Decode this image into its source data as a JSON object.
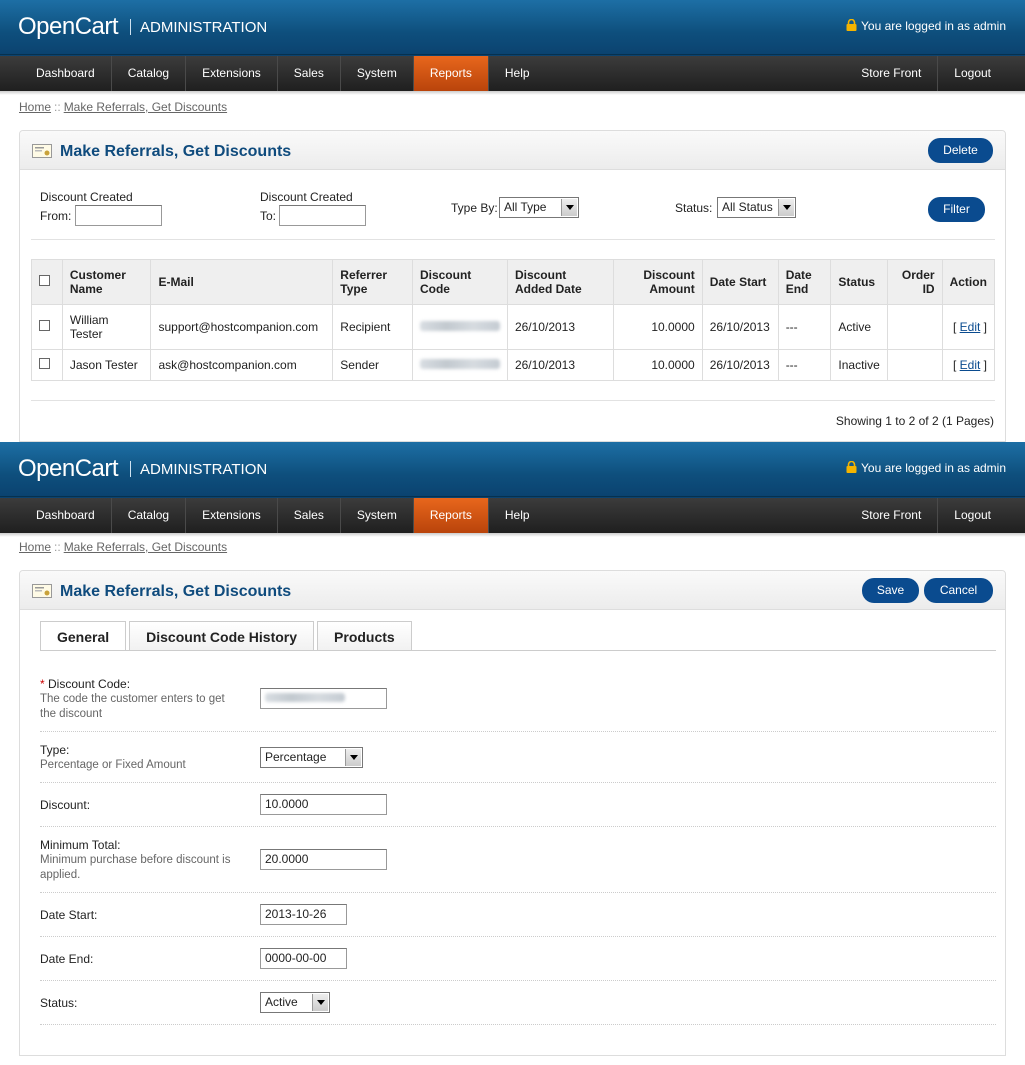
{
  "header": {
    "brand": "OpenCart",
    "section": "ADMINISTRATION",
    "login_text": "You are logged in as admin"
  },
  "nav": {
    "items": [
      "Dashboard",
      "Catalog",
      "Extensions",
      "Sales",
      "System",
      "Reports",
      "Help"
    ],
    "active": "Reports",
    "right": [
      "Store Front",
      "Logout"
    ]
  },
  "breadcrumb": {
    "home": "Home",
    "separator": "::",
    "current": "Make Referrals, Get Discounts"
  },
  "list_page": {
    "title": "Make Referrals, Get Discounts",
    "delete_button": "Delete",
    "filter": {
      "created_from_label_1": "Discount Created",
      "created_from_label_2": "From:",
      "created_to_label_1": "Discount Created",
      "created_to_label_2": "To:",
      "type_label": "Type By:",
      "type_value": "All Type",
      "status_label": "Status:",
      "status_value": "All Status",
      "filter_button": "Filter"
    },
    "columns": [
      "Customer Name",
      "E-Mail",
      "Referrer Type",
      "Discount Code",
      "Discount Added Date",
      "Discount Amount",
      "Date Start",
      "Date End",
      "Status",
      "Order ID",
      "Action"
    ],
    "rows": [
      {
        "name": "William Tester",
        "email": "support@hostcompanion.com",
        "type": "Recipient",
        "added": "26/10/2013",
        "amount": "10.0000",
        "start": "26/10/2013",
        "end": "---",
        "status": "Active",
        "order_id": "",
        "action_open": "[ ",
        "action": "Edit",
        "action_close": " ]"
      },
      {
        "name": "Jason Tester",
        "email": "ask@hostcompanion.com",
        "type": "Sender",
        "added": "26/10/2013",
        "amount": "10.0000",
        "start": "26/10/2013",
        "end": "---",
        "status": "Inactive",
        "order_id": "",
        "action_open": "[ ",
        "action": "Edit",
        "action_close": " ]"
      }
    ],
    "showing": "Showing 1 to 2 of 2 (1 Pages)"
  },
  "edit_page": {
    "title": "Make Referrals, Get Discounts",
    "save_button": "Save",
    "cancel_button": "Cancel",
    "tabs": [
      "General",
      "Discount Code History",
      "Products"
    ],
    "active_tab": "General",
    "fields": {
      "code_required": "*",
      "code_label": "Discount Code:",
      "code_help": "The code the customer enters to get the discount",
      "type_label": "Type:",
      "type_help": "Percentage or Fixed Amount",
      "type_value": "Percentage",
      "discount_label": "Discount:",
      "discount_value": "10.0000",
      "min_total_label": "Minimum Total:",
      "min_total_help": "Minimum purchase before discount is applied.",
      "min_total_value": "20.0000",
      "date_start_label": "Date Start:",
      "date_start_value": "2013-10-26",
      "date_end_label": "Date End:",
      "date_end_value": "0000-00-00",
      "status_label": "Status:",
      "status_value": "Active"
    }
  },
  "colors": {
    "header_blue": "#0e4f7d",
    "active_nav": "#e8671c",
    "button_blue": "#0a4b8f",
    "title_blue": "#0f4b7d"
  }
}
